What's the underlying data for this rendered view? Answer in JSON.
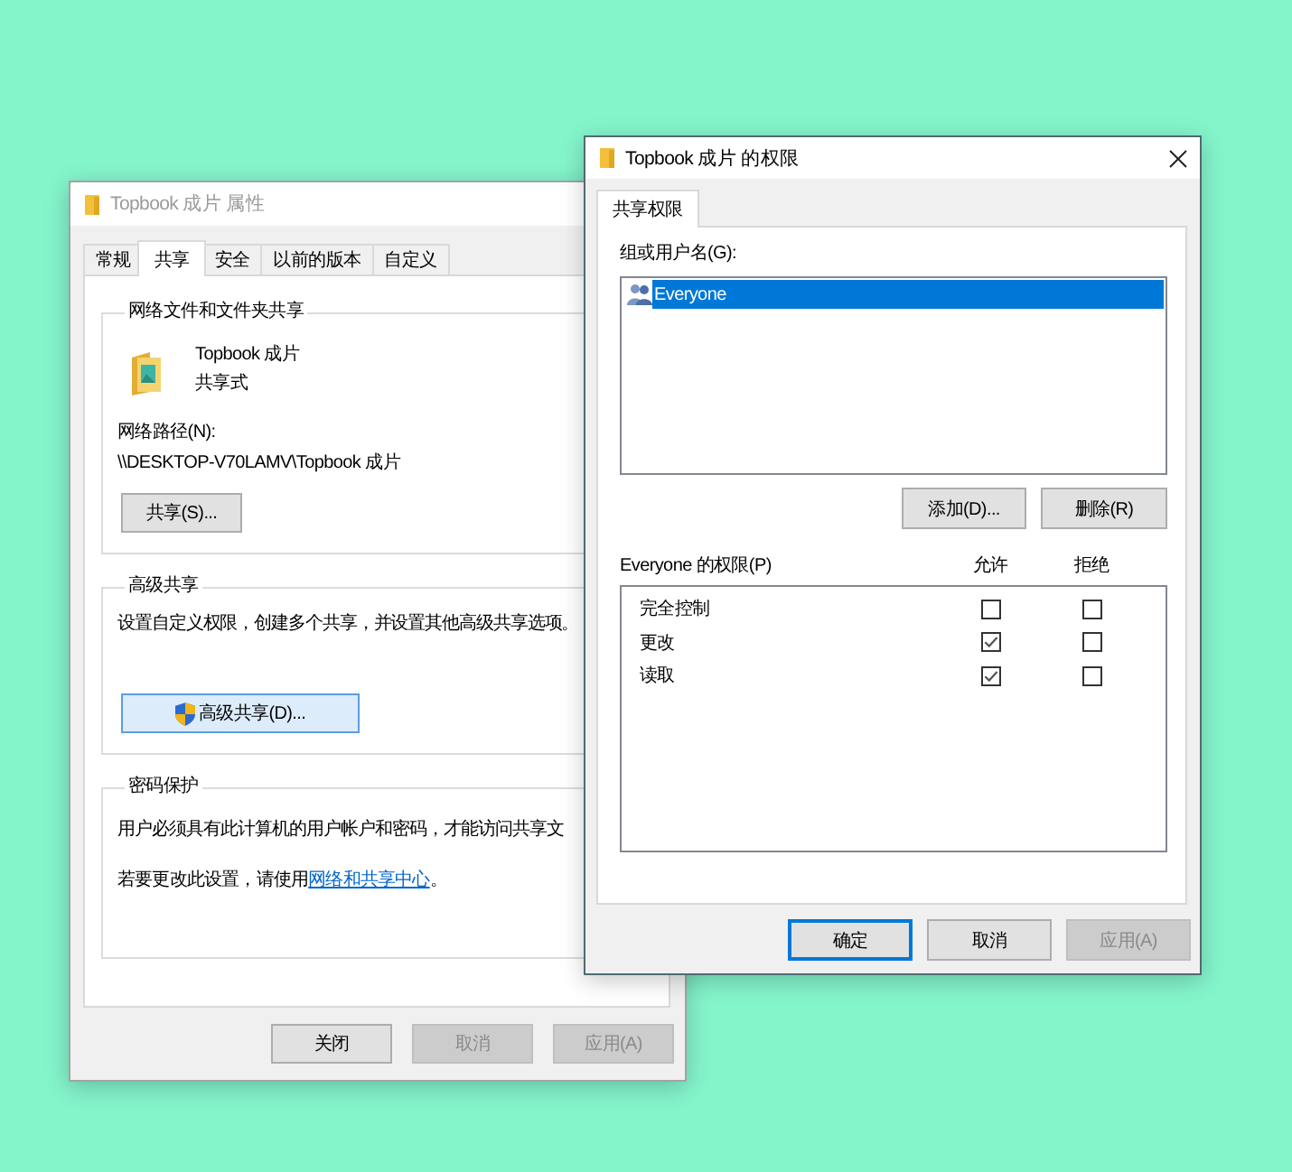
{
  "properties_window": {
    "title": "Topbook 成片 属性",
    "active": false,
    "tabs": [
      {
        "label": "常规",
        "selected": false
      },
      {
        "label": "共享",
        "selected": true
      },
      {
        "label": "安全",
        "selected": false
      },
      {
        "label": "以前的版本",
        "selected": false
      },
      {
        "label": "自定义",
        "selected": false
      }
    ],
    "network_sharing": {
      "legend": "网络文件和文件夹共享",
      "folder_name": "Topbook 成片",
      "status": "共享式",
      "path_label": "网络路径(N):",
      "path": "\\\\DESKTOP-V70LAMV\\Topbook 成片",
      "button": {
        "label": "共享(S)...",
        "highlighted": false
      }
    },
    "advanced_sharing": {
      "legend": "高级共享",
      "description": "设置自定义权限，创建多个共享，并设置其他高级共享选项。",
      "button": {
        "label": "高级共享(D)...",
        "highlighted": true
      }
    },
    "password_protection": {
      "legend": "密码保护",
      "description": "用户必须具有此计算机的用户帐户和密码，才能访问共享文",
      "hint_before": "若要更改此设置，请使用",
      "link": "网络和共享中心",
      "hint_after": "。"
    },
    "buttons": [
      {
        "label": "关闭",
        "disabled": false,
        "default": false
      },
      {
        "label": "取消",
        "disabled": true,
        "default": false
      },
      {
        "label": "应用(A)",
        "disabled": true,
        "default": false
      }
    ]
  },
  "permissions_window": {
    "title": "Topbook 成片 的权限",
    "active": true,
    "tabs": [
      {
        "label": "共享权限",
        "selected": true
      }
    ],
    "users_label": "组或用户名(G):",
    "users": [
      {
        "name": "Everyone",
        "selected": true
      }
    ],
    "user_buttons": [
      {
        "label": "添加(D)...",
        "disabled": false
      },
      {
        "label": "删除(R)",
        "disabled": false
      }
    ],
    "permissions_label": "Everyone 的权限(P)",
    "columns": [
      "允许",
      "拒绝"
    ],
    "permissions": [
      {
        "name": "完全控制",
        "allow": false,
        "deny": false
      },
      {
        "name": "更改",
        "allow": true,
        "deny": false
      },
      {
        "name": "读取",
        "allow": true,
        "deny": false
      }
    ],
    "buttons": [
      {
        "label": "确定",
        "disabled": false,
        "default": true
      },
      {
        "label": "取消",
        "disabled": false,
        "default": false
      },
      {
        "label": "应用(A)",
        "disabled": true,
        "default": false
      }
    ]
  }
}
